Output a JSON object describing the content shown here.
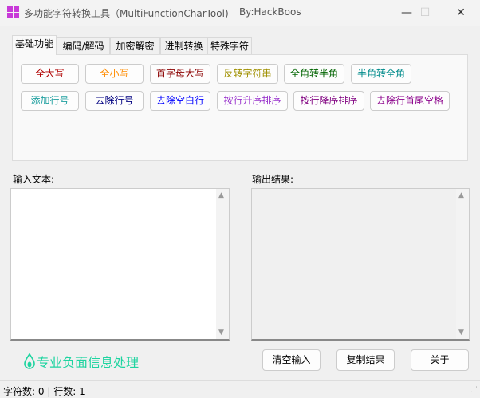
{
  "window": {
    "title": "多功能字符转换工具（MultiFunctionCharTool)",
    "author": "By:HackBoos",
    "minimize": "—",
    "maximize": "☐",
    "close": "✕"
  },
  "tabs": [
    {
      "label": "基础功能"
    },
    {
      "label": "编码/解码"
    },
    {
      "label": "加密解密"
    },
    {
      "label": "进制转换"
    },
    {
      "label": "特殊字符"
    }
  ],
  "buttons": [
    {
      "label": "全大写",
      "color": "#b00000"
    },
    {
      "label": "全小写",
      "color": "#ff8c00"
    },
    {
      "label": "首字母大写",
      "color": "#8b0000"
    },
    {
      "label": "反转字符串",
      "color": "#a09000"
    },
    {
      "label": "全角转半角",
      "color": "#006400"
    },
    {
      "label": "半角转全角",
      "color": "#008b8b"
    },
    {
      "label": "添加行号",
      "color": "#20a0a0"
    },
    {
      "label": "去除行号",
      "color": "#000080"
    },
    {
      "label": "去除空白行",
      "color": "#0000ff"
    },
    {
      "label": "按行升序排序",
      "color": "#9932cc"
    },
    {
      "label": "按行降序排序",
      "color": "#800080"
    },
    {
      "label": "去除行首尾空格",
      "color": "#8b008b"
    }
  ],
  "input": {
    "label": "输入文本:",
    "value": ""
  },
  "output": {
    "label": "输出结果:",
    "value": ""
  },
  "promo": {
    "text": "专业负面信息处理",
    "color": "#1ed4a0"
  },
  "actions": {
    "clear": "清空输入",
    "copy": "复制结果",
    "about": "关于"
  },
  "status": {
    "chars_label": "字符数:",
    "chars": "0",
    "sep": "|",
    "lines_label": "行数:",
    "lines": "1"
  }
}
